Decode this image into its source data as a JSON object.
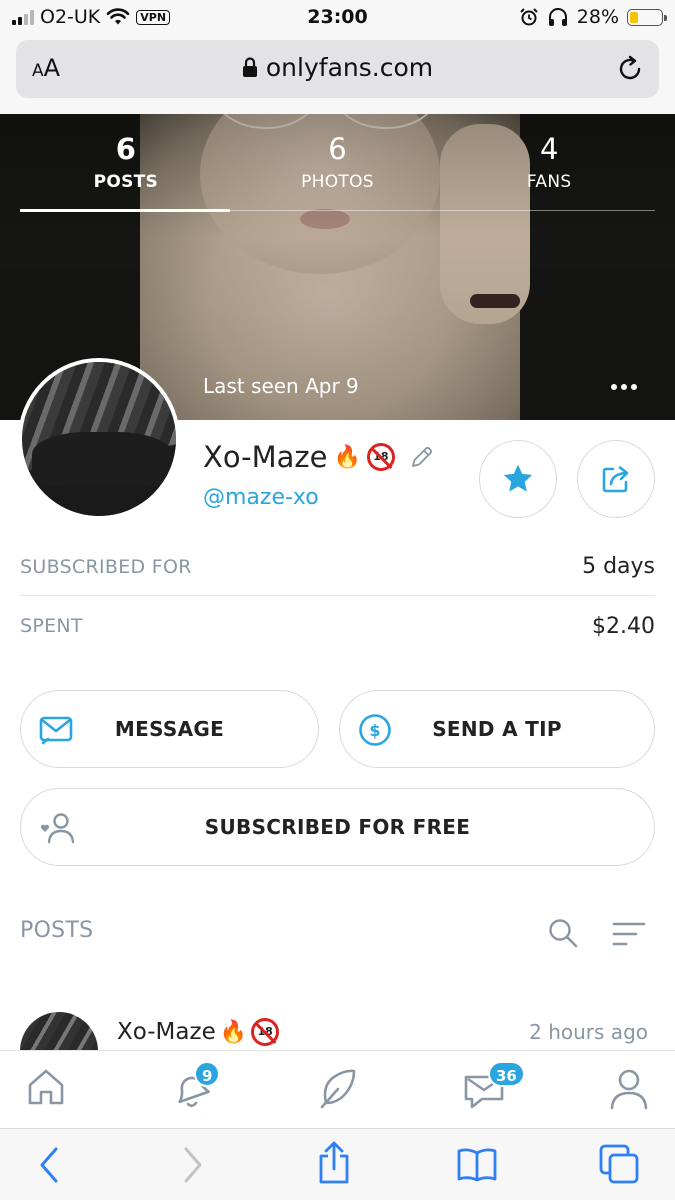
{
  "status_bar": {
    "carrier": "O2-UK",
    "vpn": "VPN",
    "time": "23:00",
    "battery": "28%",
    "battery_level": 0.28,
    "icons": [
      "signal-icon",
      "wifi-icon",
      "alarm-icon",
      "headphones-icon",
      "battery-icon"
    ]
  },
  "browser": {
    "text_size_label": "AA",
    "url": "onlyfans.com",
    "icons": [
      "lock-icon",
      "reload-icon"
    ]
  },
  "cover": {
    "stats": [
      {
        "count": "6",
        "label": "POSTS",
        "active": true
      },
      {
        "count": "6",
        "label": "PHOTOS",
        "active": false
      },
      {
        "count": "4",
        "label": "FANS",
        "active": false
      }
    ],
    "last_seen": "Last seen Apr 9"
  },
  "profile": {
    "name": "Xo-Maze",
    "name_emoji": "🔥",
    "handle": "@maze-xo",
    "adult_badge": "18"
  },
  "info": {
    "subscribed_for_label": "SUBSCRIBED FOR",
    "subscribed_for_value": "5 days",
    "spent_label": "SPENT",
    "spent_value": "$2.40"
  },
  "actions": {
    "message": "MESSAGE",
    "tip": "SEND A TIP",
    "subscribed": "SUBSCRIBED FOR FREE"
  },
  "posts": {
    "title": "POSTS",
    "first_post": {
      "author": "Xo-Maze",
      "author_emoji": "🔥",
      "time": "2 hours ago"
    }
  },
  "bottom_nav": {
    "notifications_badge": "9",
    "messages_badge": "36",
    "items": [
      "home-icon",
      "bell-icon",
      "feather-icon",
      "messages-icon",
      "profile-icon"
    ]
  },
  "colors": {
    "accent": "#2aa5e0",
    "muted": "#8a96a3",
    "battery": "#f5c400"
  }
}
